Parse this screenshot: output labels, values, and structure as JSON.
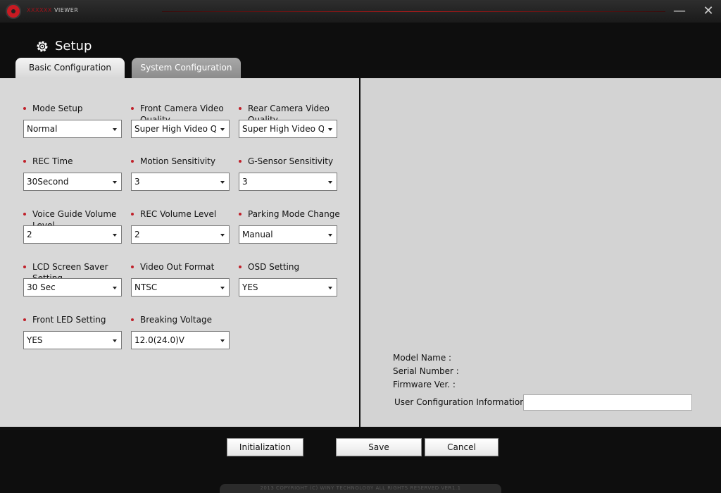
{
  "window": {
    "title_red": "XXXXXX",
    "title": "VIEWER",
    "minimize": "—",
    "close": "✕"
  },
  "header": {
    "title": "Setup",
    "icon": "gear-icon"
  },
  "tabs": [
    {
      "label": "Basic Configuration",
      "active": true
    },
    {
      "label": "System Configuration",
      "active": false
    }
  ],
  "fields": [
    {
      "label": "Mode Setup",
      "value": "Normal"
    },
    {
      "label": "Front Camera Video Quality",
      "value": "Super High Video Quality"
    },
    {
      "label": "Rear Camera Video Quality",
      "value": "Super High Video Quality"
    },
    {
      "label": "REC Time",
      "value": "30Second"
    },
    {
      "label": "Motion Sensitivity",
      "value": "3"
    },
    {
      "label": "G-Sensor Sensitivity",
      "value": "3"
    },
    {
      "label": "Voice Guide Volume Level",
      "value": "2"
    },
    {
      "label": "REC Volume Level",
      "value": "2"
    },
    {
      "label": "Parking Mode Change",
      "value": "Manual"
    },
    {
      "label": "LCD Screen Saver Setting",
      "value": "30 Sec"
    },
    {
      "label": "Video Out Format",
      "value": "NTSC"
    },
    {
      "label": "OSD Setting",
      "value": "YES"
    },
    {
      "label": "Front LED Setting",
      "value": "YES"
    },
    {
      "label": "Breaking Voltage",
      "value": "12.0(24.0)V"
    }
  ],
  "info": {
    "model_name": "Model Name :",
    "serial_number": "Serial Number :",
    "firmware": "Firmware Ver. :",
    "user_config": "User Configuration Information",
    "user_config_value": ""
  },
  "buttons": {
    "initialization": "Initialization",
    "save": "Save",
    "cancel": "Cancel"
  },
  "footer": "2013 COPYRIGHT (C) WINY TECHNOLOGY ALL RIGHTS RESERVED VER1.1",
  "colors": {
    "accent": "#c0202a",
    "background": "#0e0e0e",
    "panel": "#d8d8d8"
  }
}
